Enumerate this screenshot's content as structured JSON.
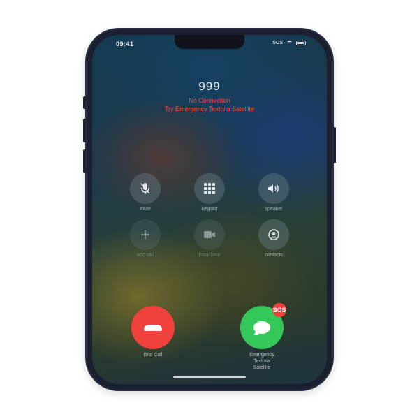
{
  "status_bar": {
    "time": "09:41",
    "network": "SOS"
  },
  "call": {
    "number": "999",
    "status_line1": "No Connection",
    "status_line2": "Try Emergency Text via Satellite"
  },
  "controls": [
    {
      "label": "mute",
      "icon": "microphone-slash-icon",
      "enabled": true
    },
    {
      "label": "keypad",
      "icon": "keypad-icon",
      "enabled": true
    },
    {
      "label": "speaker",
      "icon": "speaker-icon",
      "enabled": true
    },
    {
      "label": "add call",
      "icon": "plus-icon",
      "enabled": false
    },
    {
      "label": "FaceTime",
      "icon": "video-camera-icon",
      "enabled": false
    },
    {
      "label": "contacts",
      "icon": "contacts-icon",
      "enabled": true
    }
  ],
  "end_call": {
    "label": "End Call",
    "color": "#f0413c"
  },
  "message": {
    "label_line1": "Emergency",
    "label_line2": "Text via",
    "label_line3": "Satellite",
    "badge": "SOS",
    "color": "#34c759"
  }
}
